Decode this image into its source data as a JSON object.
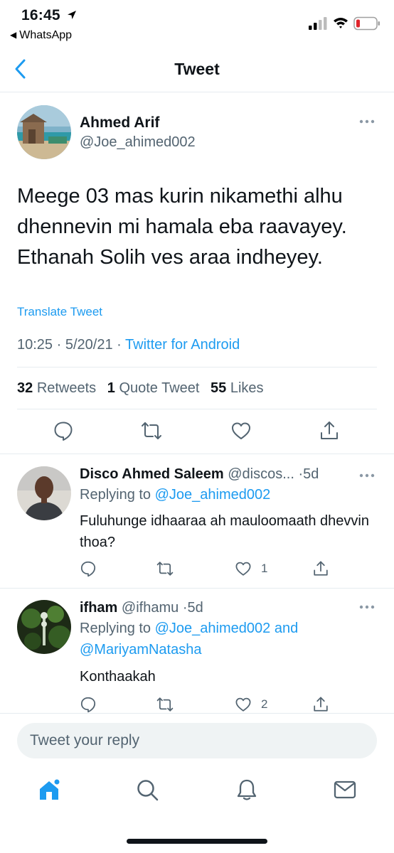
{
  "status": {
    "time": "16:45",
    "back_app": "WhatsApp"
  },
  "nav": {
    "title": "Tweet"
  },
  "tweet": {
    "author_name": "Ahmed Arif",
    "author_handle": "@Joe_ahimed002",
    "text": "Meege 03 mas kurin nikamethi alhu dhennevin mi hamala eba raavayey. Ethanah Solih ves araa indheyey.",
    "translate": "Translate Tweet",
    "time": "10:25",
    "date": "5/20/21",
    "source": "Twitter for Android",
    "stats": {
      "retweets_count": "32",
      "retweets_label": "Retweets",
      "quotes_count": "1",
      "quotes_label": "Quote Tweet",
      "likes_count": "55",
      "likes_label": "Likes"
    }
  },
  "replies": [
    {
      "name": "Disco Ahmed Saleem",
      "handle": "@discos...",
      "age": "5d",
      "replying_prefix": "Replying to",
      "replying_to": "@Joe_ahimed002",
      "replying_to_2": "",
      "text": "Fuluhunge idhaaraa ah mauloomaath dhevvin thoa?",
      "likes": "1"
    },
    {
      "name": "ifham",
      "handle": "@ifhamu",
      "age": "5d",
      "replying_prefix": "Replying to",
      "replying_to": "@Joe_ahimed002",
      "replying_to_and": "and",
      "replying_to_2": "@MariyamNatasha",
      "text": "Konthaakah",
      "likes": "2"
    }
  ],
  "reply_box": {
    "placeholder": "Tweet your reply"
  },
  "colors": {
    "accent": "#1d9bf0",
    "text": "#0f1419",
    "muted": "#536471",
    "divider": "#e6ecf0",
    "battery_low": "#e0242b"
  },
  "icons": {
    "reply": "reply-icon",
    "retweet": "retweet-icon",
    "like": "heart-icon",
    "share": "share-icon",
    "home": "home-icon",
    "search": "search-icon",
    "notifications": "bell-icon",
    "messages": "mail-icon"
  }
}
